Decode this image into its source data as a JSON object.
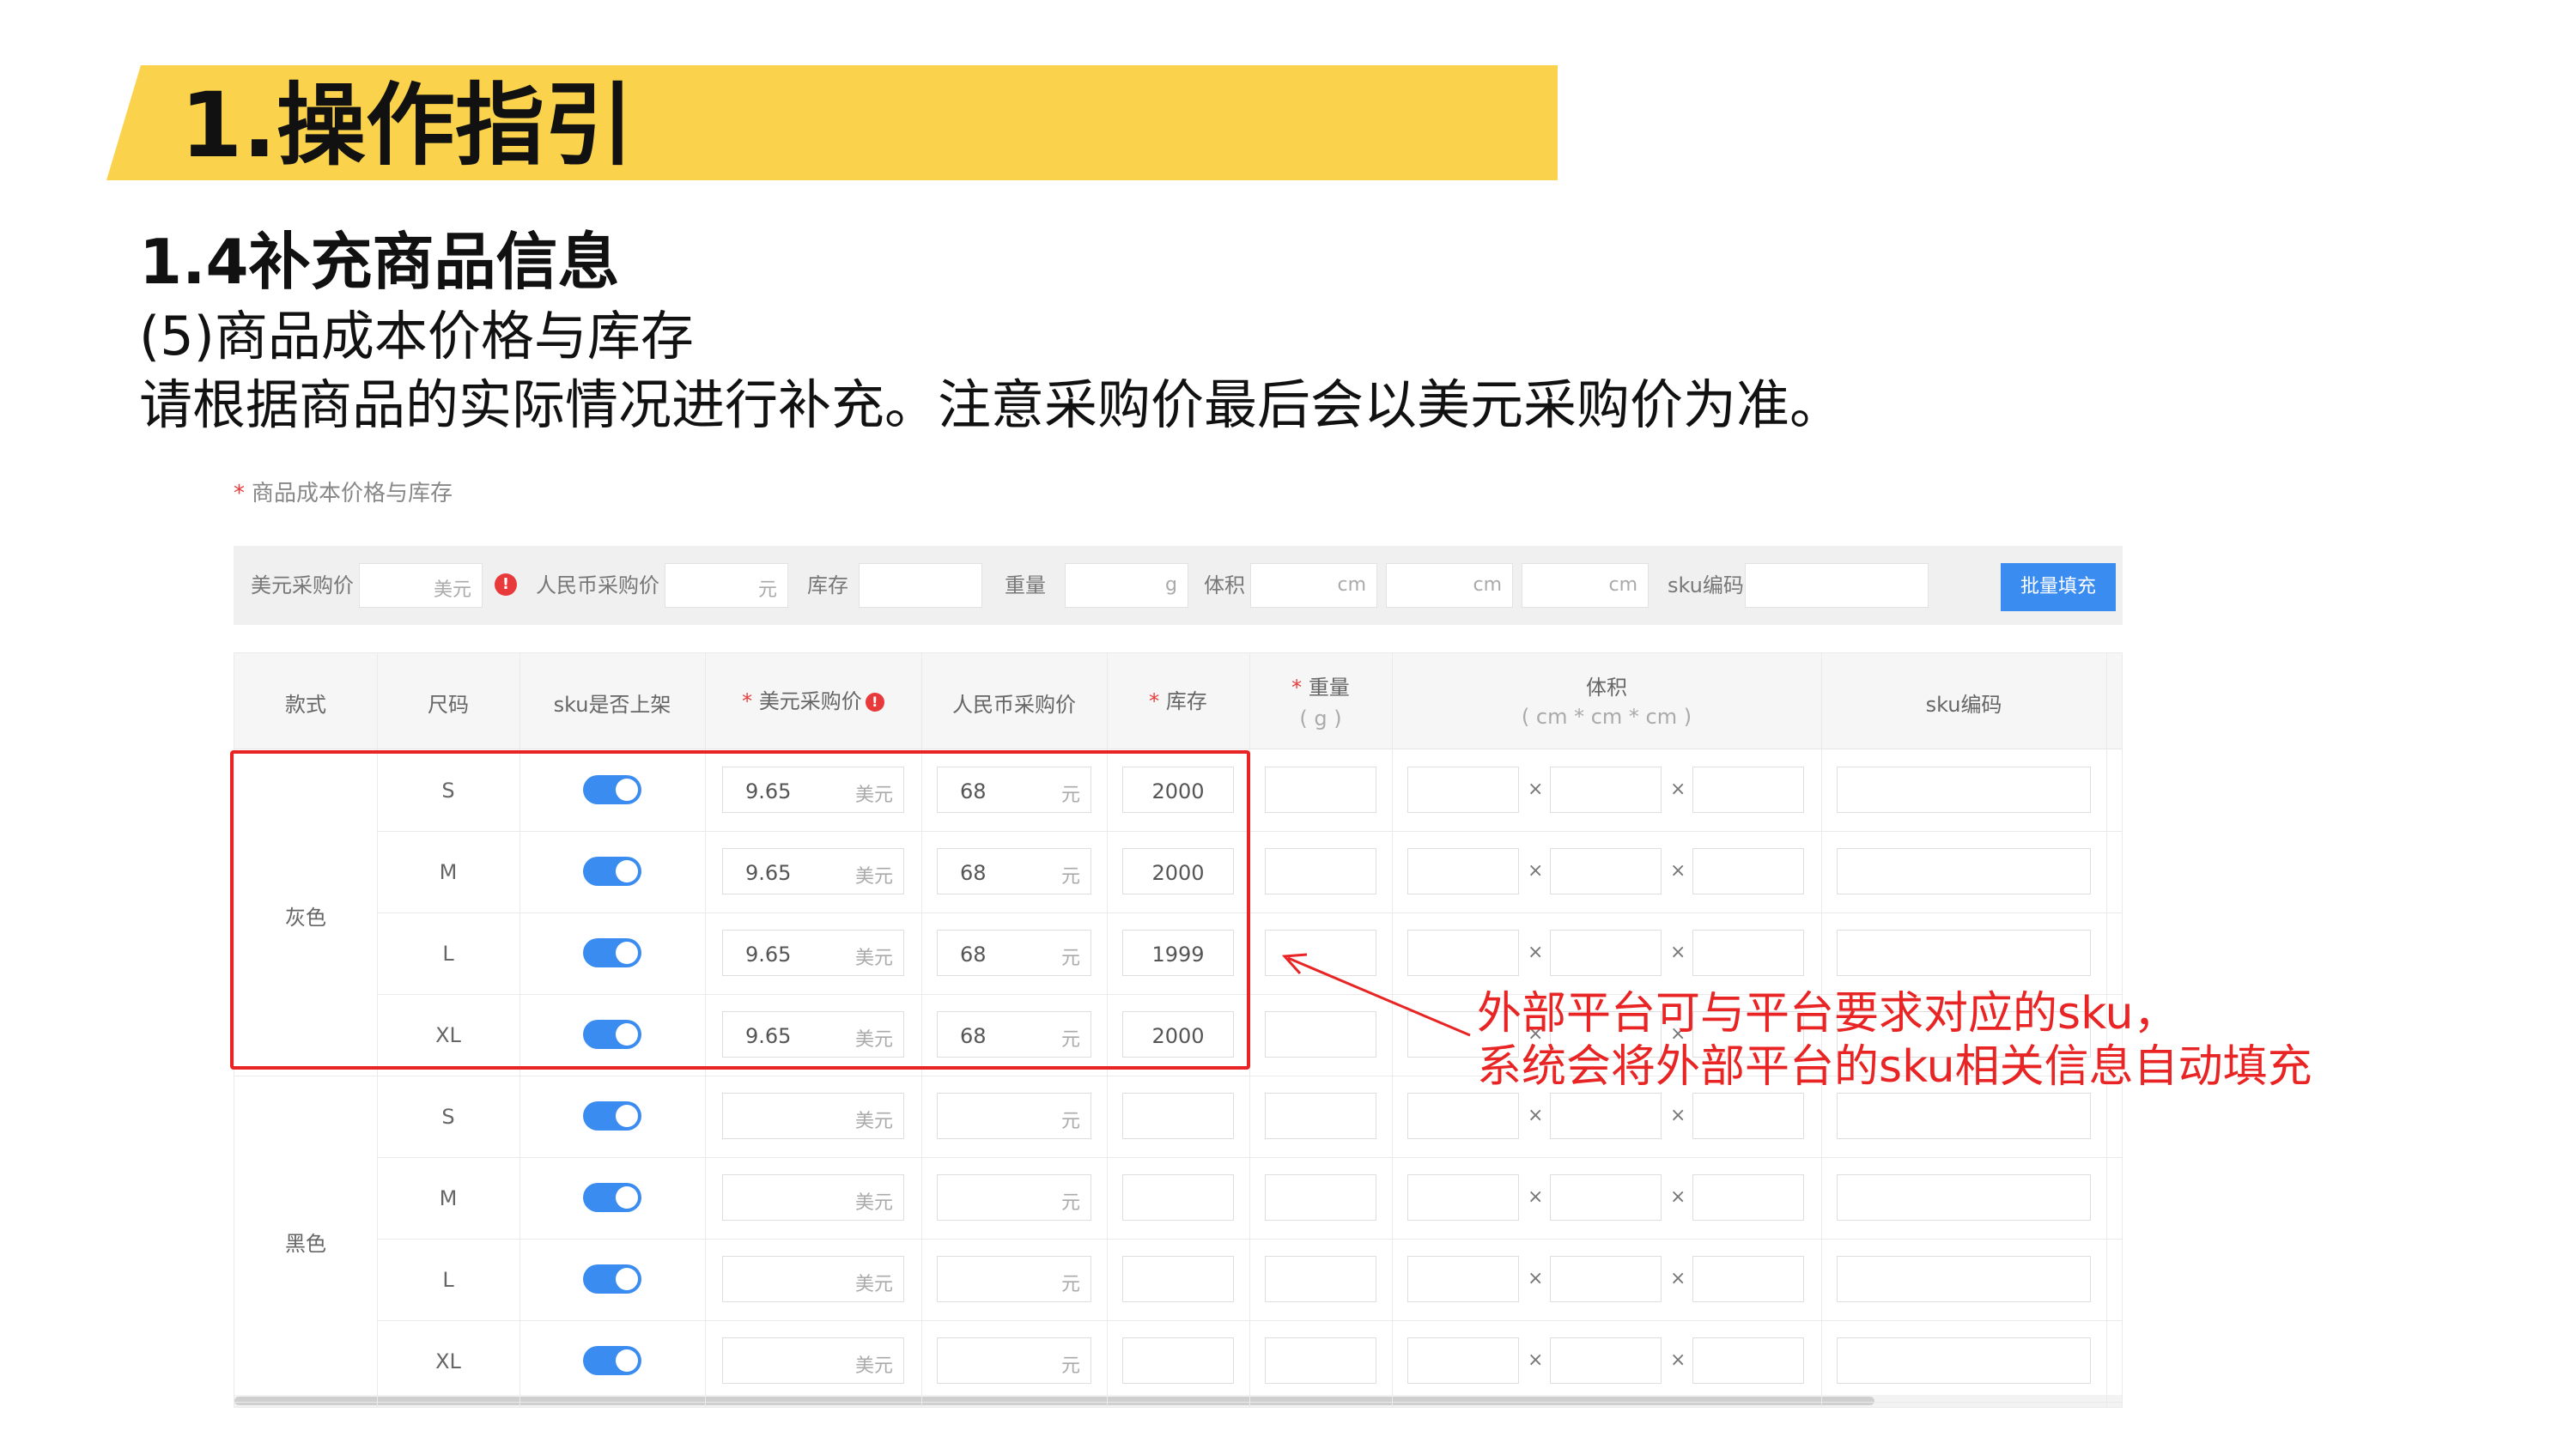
{
  "slide": {
    "banner_title": "1.操作指引",
    "subtitle": "1.4补充商品信息",
    "line1": "(5)商品成本价格与库存",
    "line2": "请根据商品的实际情况进行补充。注意采购价最后会以美元采购价为准。",
    "section_star": "*",
    "section_label": "商品成本价格与库存"
  },
  "toolbar": {
    "usd_label": "美元采购价",
    "usd_unit": "美元",
    "warn": "!",
    "cny_label": "人民币采购价",
    "cny_unit": "元",
    "stock_label": "库存",
    "weight_label": "重量",
    "weight_unit": "g",
    "volume_label": "体积",
    "cm": "cm",
    "sku_label": "sku编码",
    "batch_button": "批量填充"
  },
  "table": {
    "headers": {
      "style": "款式",
      "size": "尺码",
      "listed": "sku是否上架",
      "usd": "美元采购价",
      "cny": "人民币采购价",
      "stock": "库存",
      "weight": "重量",
      "weight_unit": "( g )",
      "volume": "体积",
      "volume_unit": "( cm * cm * cm )",
      "sku": "sku编码",
      "star": "*",
      "warn": "!"
    },
    "units": {
      "usd": "美元",
      "cny": "元",
      "times": "×"
    },
    "groups": [
      {
        "color": "灰色",
        "rows": [
          {
            "size": "S",
            "usd": "9.65",
            "cny": "68",
            "stock": "2000"
          },
          {
            "size": "M",
            "usd": "9.65",
            "cny": "68",
            "stock": "2000"
          },
          {
            "size": "L",
            "usd": "9.65",
            "cny": "68",
            "stock": "1999"
          },
          {
            "size": "XL",
            "usd": "9.65",
            "cny": "68",
            "stock": "2000"
          }
        ]
      },
      {
        "color": "黑色",
        "rows": [
          {
            "size": "S",
            "usd": "",
            "cny": "",
            "stock": ""
          },
          {
            "size": "M",
            "usd": "",
            "cny": "",
            "stock": ""
          },
          {
            "size": "L",
            "usd": "",
            "cny": "",
            "stock": ""
          },
          {
            "size": "XL",
            "usd": "",
            "cny": "",
            "stock": ""
          }
        ]
      }
    ]
  },
  "annotation": {
    "line1": "外部平台可与平台要求对应的sku，",
    "line2": "系统会将外部平台的sku相关信息自动填充",
    "color": "#e82424"
  },
  "colors": {
    "banner": "#fbd24c",
    "accent": "#3b8cf0",
    "alert": "#e82424"
  }
}
